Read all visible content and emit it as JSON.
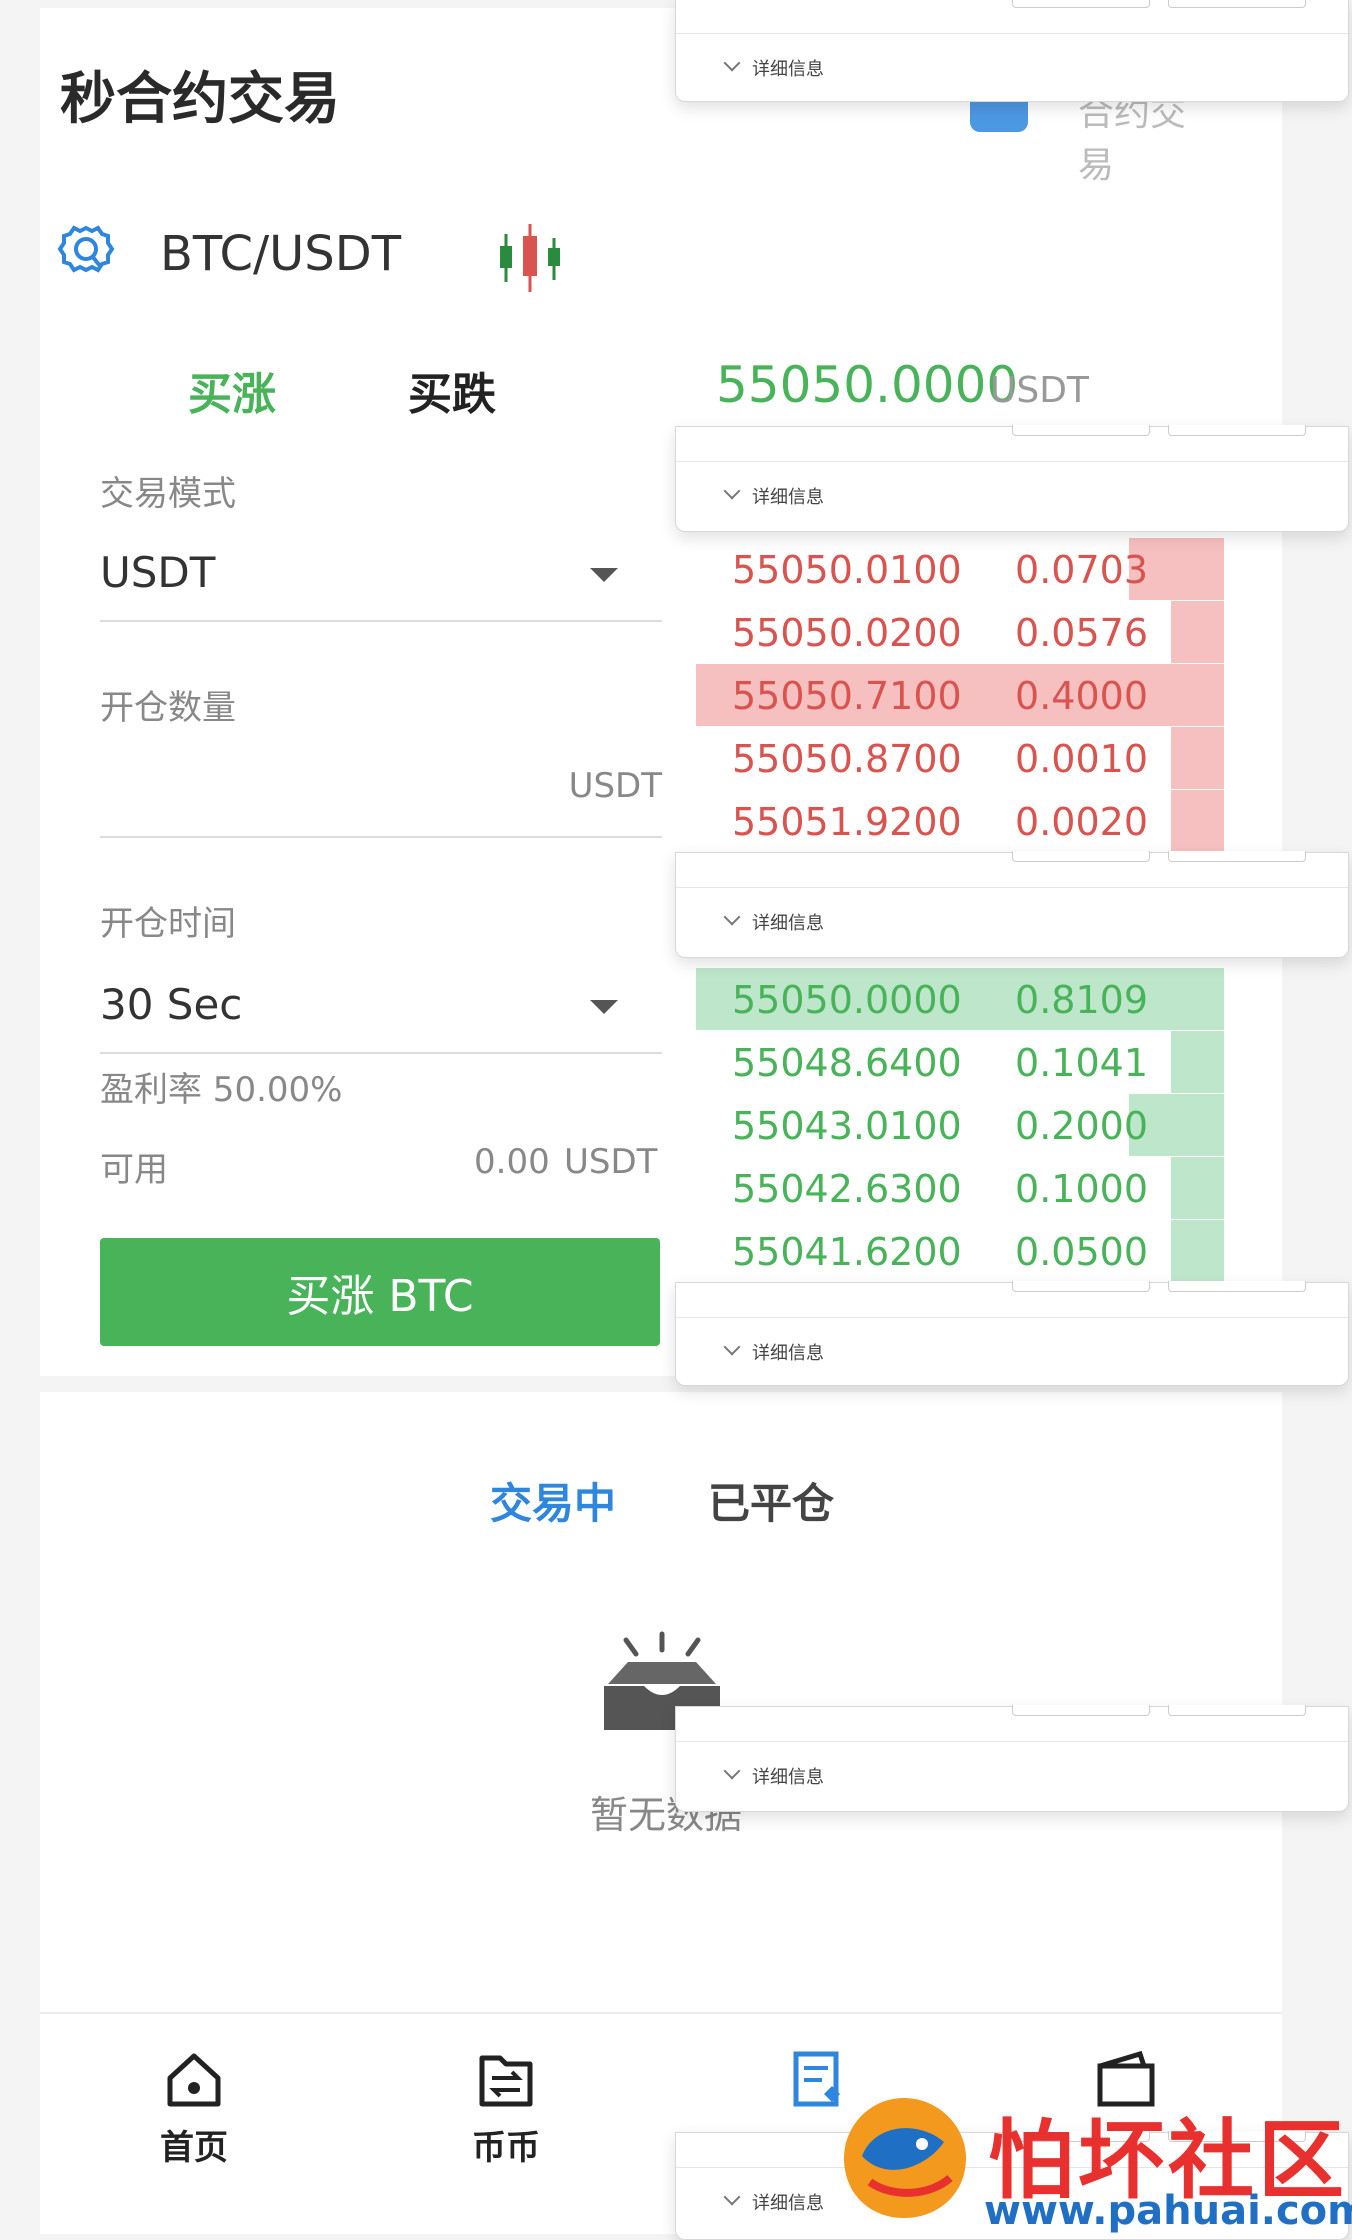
{
  "header": {
    "title": "秒合约交易",
    "right_link": "合约交易"
  },
  "pair": {
    "symbol": "BTC/USDT",
    "settings_icon": "gear-icon",
    "chart_icon": "candlestick-icon"
  },
  "trade_tabs": {
    "buy_up": "买涨",
    "buy_down": "买跌"
  },
  "current_price": {
    "value": "55050.0000",
    "unit": "USDT"
  },
  "form": {
    "mode_label": "交易模式",
    "mode_value": "USDT",
    "amount_label": "开仓数量",
    "amount_unit": "USDT",
    "time_label": "开仓时间",
    "time_value": "30 Sec",
    "profit_rate": "盈利率 50.00%",
    "available_label": "可用",
    "available_value": "0.00",
    "available_unit": "USDT",
    "submit_label": "买涨 BTC"
  },
  "orderbook": {
    "asks": [
      {
        "price": "55050.0100",
        "qty": "0.0703",
        "depth": 0.18
      },
      {
        "price": "55050.0200",
        "qty": "0.0576",
        "depth": 0.1
      },
      {
        "price": "55050.7100",
        "qty": "0.4000",
        "depth": 1.0
      },
      {
        "price": "55050.8700",
        "qty": "0.0010",
        "depth": 0.1
      },
      {
        "price": "55051.9200",
        "qty": "0.0020",
        "depth": 0.1
      }
    ],
    "bids": [
      {
        "price": "55050.0000",
        "qty": "0.8109",
        "depth": 1.0
      },
      {
        "price": "55048.6400",
        "qty": "0.1041",
        "depth": 0.1
      },
      {
        "price": "55043.0100",
        "qty": "0.2000",
        "depth": 0.18
      },
      {
        "price": "55042.6300",
        "qty": "0.1000",
        "depth": 0.1
      },
      {
        "price": "55041.6200",
        "qty": "0.0500",
        "depth": 0.1
      }
    ]
  },
  "positions_tabs": {
    "active": "交易中",
    "closed": "已平仓"
  },
  "empty_state": {
    "text": "暂无数据",
    "icon": "empty-box-icon"
  },
  "popup": {
    "details_label": "详细信息"
  },
  "bottom_nav": [
    {
      "label": "首页",
      "icon": "home-icon"
    },
    {
      "label": "币币",
      "icon": "exchange-icon"
    },
    {
      "label": "",
      "icon": "contract-icon"
    },
    {
      "label": "",
      "icon": "wallet-icon"
    }
  ],
  "watermark": {
    "text": "怕坏社区",
    "url": "www.pahuai.com"
  },
  "colors": {
    "up": "#49b35a",
    "down": "#d9534f",
    "accent": "#2e86de"
  }
}
